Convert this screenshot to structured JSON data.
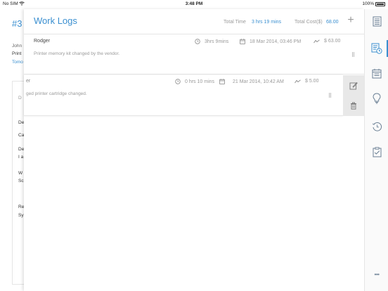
{
  "status_bar": {
    "carrier": "No SIM",
    "time": "3:48 PM",
    "battery": "100%"
  },
  "background": {
    "ticket_id": "#3",
    "lines": [
      "John",
      "Print",
      "Tomo"
    ],
    "card_rows": [
      "D",
      "De",
      "Ca",
      "De",
      "I a",
      "W",
      "Sc",
      "Re",
      "Sy"
    ]
  },
  "panel": {
    "title": "Work Logs",
    "total_time_label": "Total Time",
    "total_time_value": "3 hrs 19 mins",
    "total_cost_label": "Total Cost($)",
    "total_cost_value": "68.00",
    "add_label": "+"
  },
  "logs": [
    {
      "author": "Rodger",
      "description": "Printer memory kit changed by the vendor.",
      "duration": "3hrs 9mins",
      "date": "18 Mar 2014, 03:46 PM",
      "cost": "$ 63.00"
    },
    {
      "author": "er",
      "description": "ged printer cartridge changed.",
      "duration": "0 hrs 10 mins",
      "date": "21 Mar 2014, 10:42 AM",
      "cost": "$ 5.00"
    }
  ],
  "sidebar": {
    "items": [
      "details-icon",
      "worklog-icon",
      "calendar-icon",
      "solution-icon",
      "history-icon",
      "checklist-icon"
    ],
    "more": "•••"
  },
  "colors": {
    "accent": "#3a8fd0",
    "muted": "#9a9a9a"
  }
}
